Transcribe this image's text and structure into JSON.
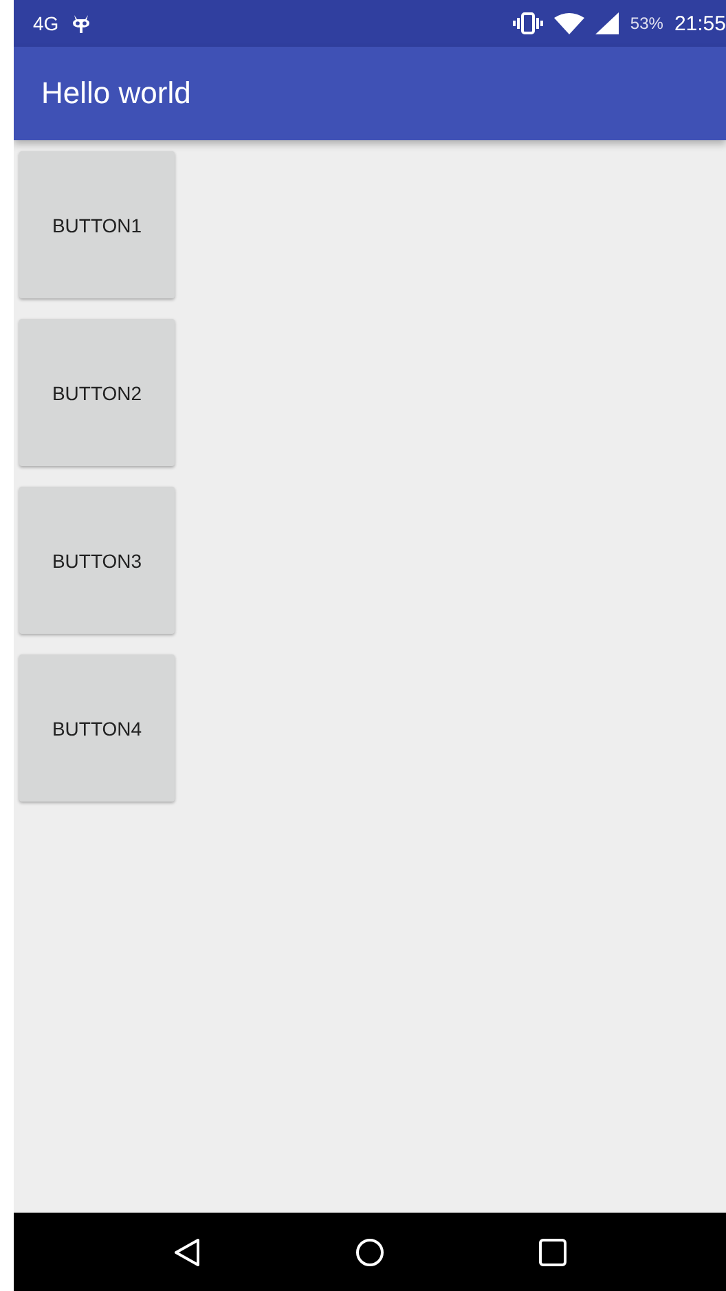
{
  "status_bar": {
    "network": "4G",
    "battery": "53%",
    "time": "21:55"
  },
  "app_bar": {
    "title": "Hello world"
  },
  "buttons": [
    "BUTTON1",
    "BUTTON2",
    "BUTTON3",
    "BUTTON4"
  ]
}
